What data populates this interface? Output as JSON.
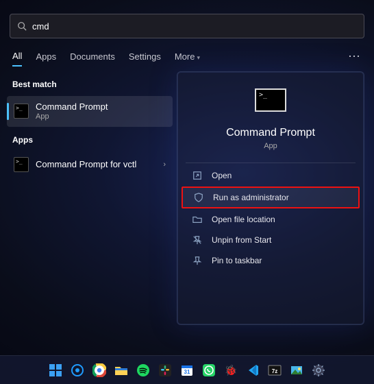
{
  "search": {
    "value": "cmd"
  },
  "tabs": {
    "all": "All",
    "apps": "Apps",
    "documents": "Documents",
    "settings": "Settings",
    "more": "More"
  },
  "sections": {
    "best_match": "Best match",
    "apps": "Apps"
  },
  "results": {
    "best": {
      "title": "Command Prompt",
      "sub": "App"
    },
    "app1": {
      "title": "Command Prompt for vctl"
    }
  },
  "preview": {
    "title": "Command Prompt",
    "sub": "App",
    "actions": {
      "open": "Open",
      "run_admin": "Run as administrator",
      "open_loc": "Open file location",
      "unpin_start": "Unpin from Start",
      "pin_taskbar": "Pin to taskbar"
    }
  }
}
